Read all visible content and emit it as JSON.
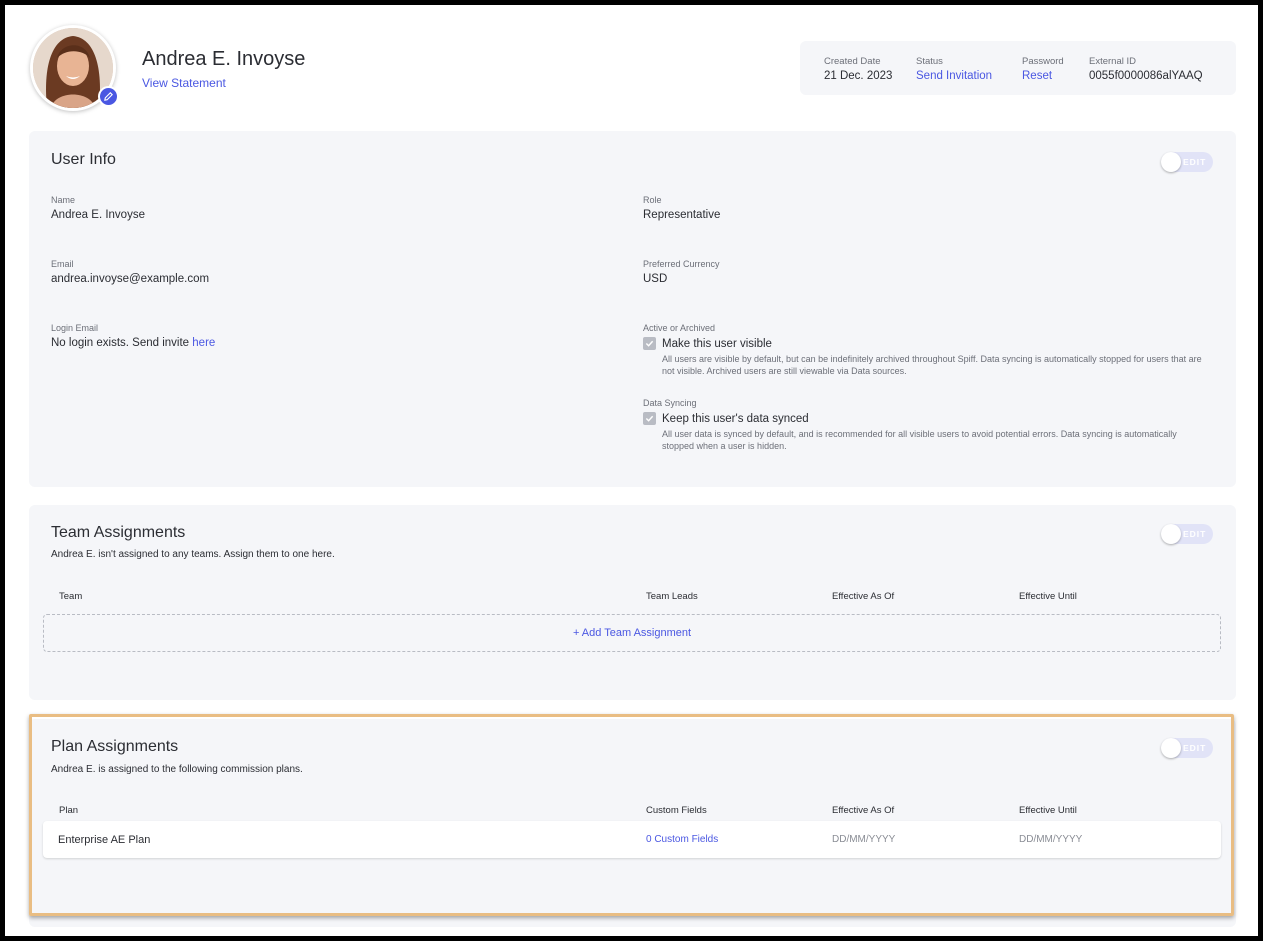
{
  "profile": {
    "name": "Andrea E. Invoyse",
    "view_statement": "View Statement"
  },
  "meta": {
    "created_label": "Created Date",
    "created_value": "21 Dec. 2023",
    "status_label": "Status",
    "status_value": "Send Invitation",
    "password_label": "Password",
    "password_value": "Reset",
    "external_label": "External ID",
    "external_value": "0055f0000086alYAAQ"
  },
  "user_info": {
    "title": "User Info",
    "toggle_label": "EDIT",
    "name_label": "Name",
    "name_value": "Andrea E. Invoyse",
    "email_label": "Email",
    "email_value": "andrea.invoyse@example.com",
    "login_label": "Login Email",
    "login_value": "No login exists. Send invite",
    "login_link": "here",
    "role_label": "Role",
    "role_value": "Representative",
    "currency_label": "Preferred Currency",
    "currency_value": "USD",
    "active_label": "Active or Archived",
    "active_check": "Make this user visible",
    "active_help": "All users are visible by default, but can be indefinitely archived throughout Spiff. Data syncing is automatically stopped for users that are not visible. Archived users are still viewable via Data sources.",
    "sync_label": "Data Syncing",
    "sync_check": "Keep this user's data synced",
    "sync_help": "All user data is synced by default, and is recommended for all visible users to avoid potential errors. Data syncing is automatically stopped when a user is hidden."
  },
  "team": {
    "title": "Team Assignments",
    "subtitle": "Andrea E. isn't assigned to any teams. Assign them to one here.",
    "toggle_label": "EDIT",
    "columns": [
      "Team",
      "Team Leads",
      "Effective As Of",
      "Effective Until"
    ],
    "add_label": "+ Add Team Assignment"
  },
  "plan": {
    "title": "Plan Assignments",
    "subtitle": "Andrea E. is assigned to the following commission plans.",
    "toggle_label": "EDIT",
    "columns": [
      "Plan",
      "Custom Fields",
      "Effective As Of",
      "Effective Until"
    ],
    "rows": [
      {
        "plan": "Enterprise AE Plan",
        "custom_fields": "0 Custom Fields",
        "effective_as_of": "DD/MM/YYYY",
        "effective_until": "DD/MM/YYYY"
      }
    ]
  },
  "colors": {
    "accent": "#4a57e2",
    "highlight": "#e9bd83",
    "card_bg": "#f5f6f9"
  }
}
